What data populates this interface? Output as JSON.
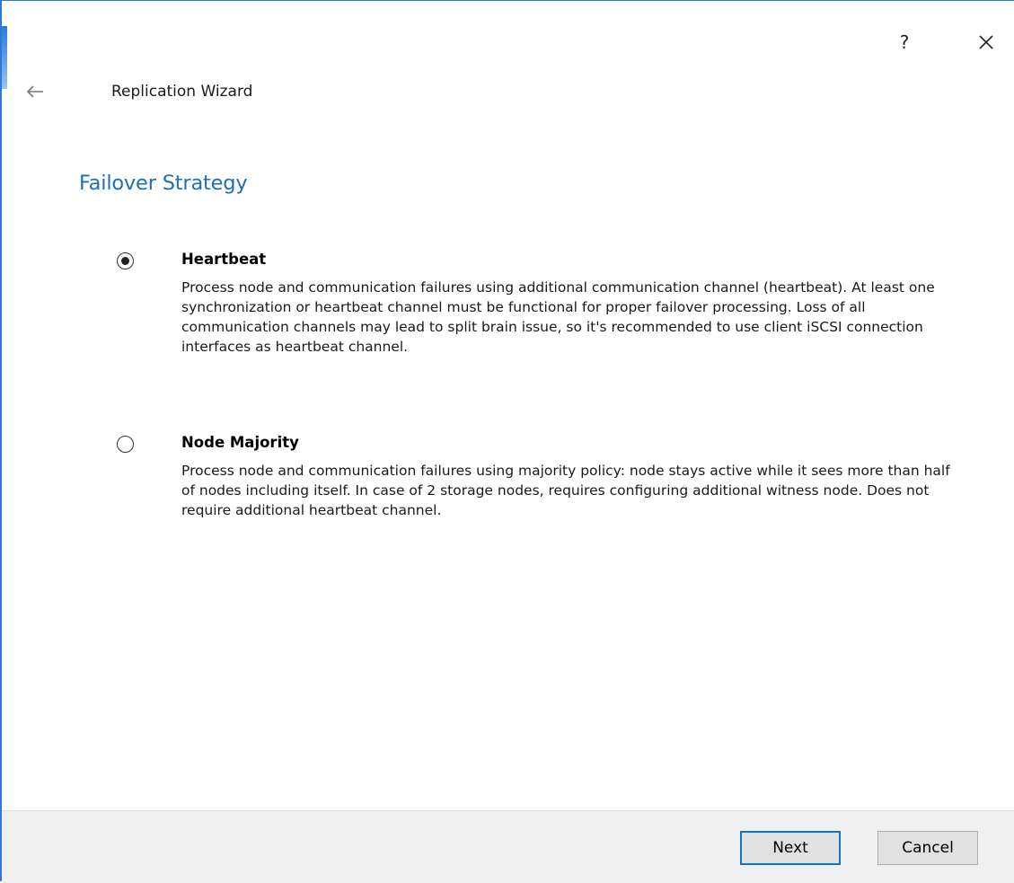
{
  "window": {
    "title": "Replication Wizard",
    "help_label": "?"
  },
  "page": {
    "heading": "Failover Strategy"
  },
  "options": [
    {
      "title": "Heartbeat",
      "selected": true,
      "description": "Process node and communication failures using additional communication channel (heartbeat). At least one synchronization or heartbeat channel must be functional for proper failover processing. Loss of all communication channels may lead to split brain issue, so it's recommended to use client iSCSI connection interfaces as heartbeat channel."
    },
    {
      "title": "Node Majority",
      "selected": false,
      "description": "Process node and communication failures using majority policy: node stays active while it sees more than half of nodes including itself. In case of 2 storage nodes, requires configuring additional witness node. Does not require additional heartbeat channel."
    }
  ],
  "footer": {
    "next_label": "Next",
    "cancel_label": "Cancel"
  },
  "colors": {
    "accent": "#1e6fb5",
    "focus_border": "#0078d7"
  }
}
